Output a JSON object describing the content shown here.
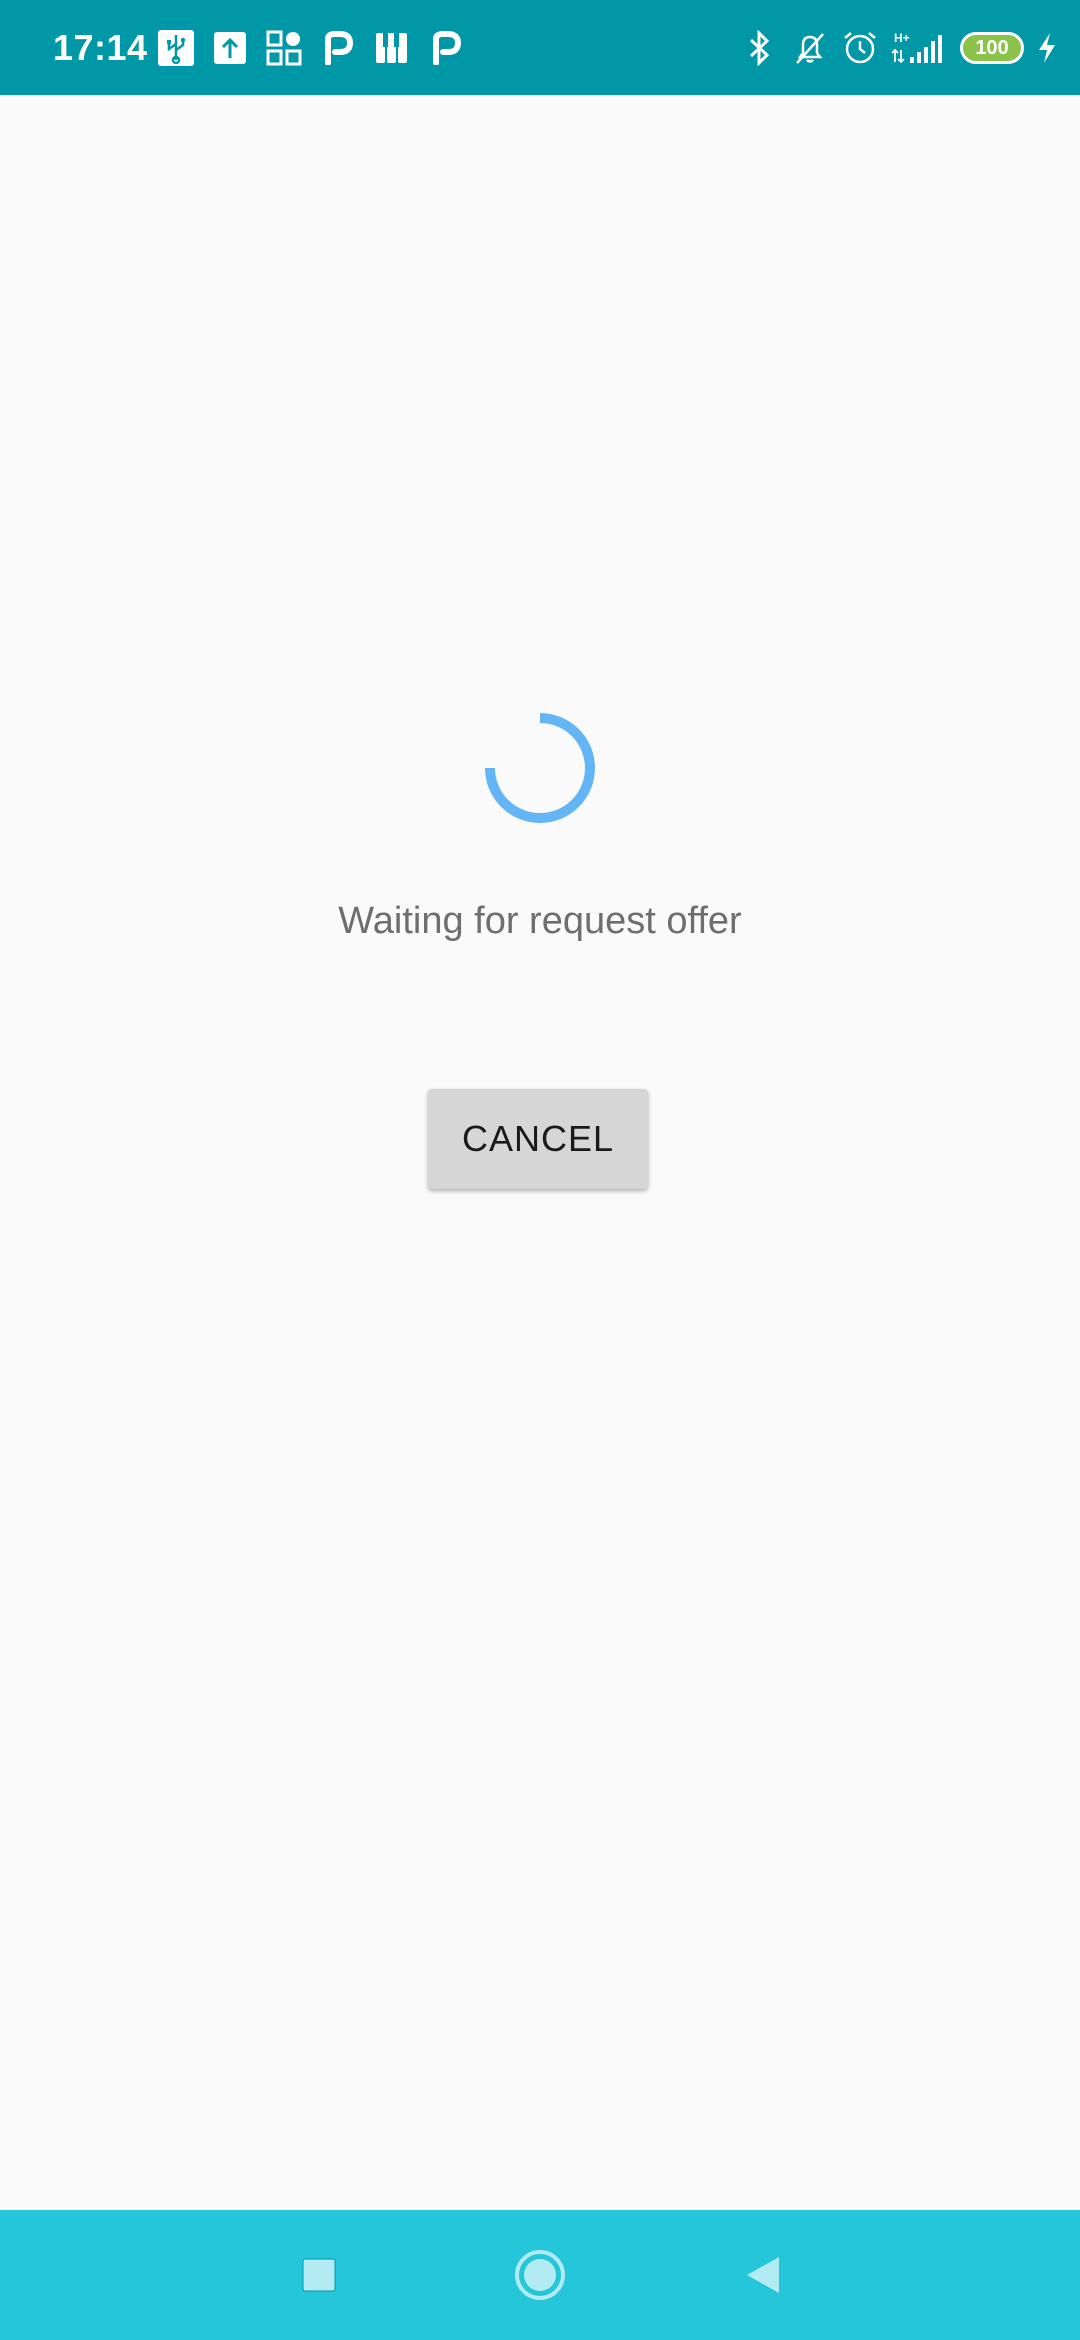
{
  "status_bar": {
    "time": "17:14",
    "battery": "100",
    "left_icons": [
      "usb-icon",
      "upload-icon",
      "apps-icon",
      "p-app-icon",
      "piano-icon",
      "p-app-icon"
    ],
    "right_icons": [
      "bluetooth-icon",
      "bell-off-icon",
      "alarm-icon",
      "signal-icon",
      "battery-icon",
      "charging-icon"
    ],
    "network_label": "H+"
  },
  "main": {
    "message": "Waiting for request offer",
    "cancel_label": "CANCEL"
  },
  "colors": {
    "status_bar": "#0097a7",
    "nav_bar": "#26c6da",
    "spinner": "#64b5f6",
    "background": "#fafafa",
    "button": "#d6d6d6",
    "battery": "#8bc34a"
  },
  "nav_bar": {
    "buttons": [
      "recents-icon",
      "home-icon",
      "back-icon"
    ]
  }
}
